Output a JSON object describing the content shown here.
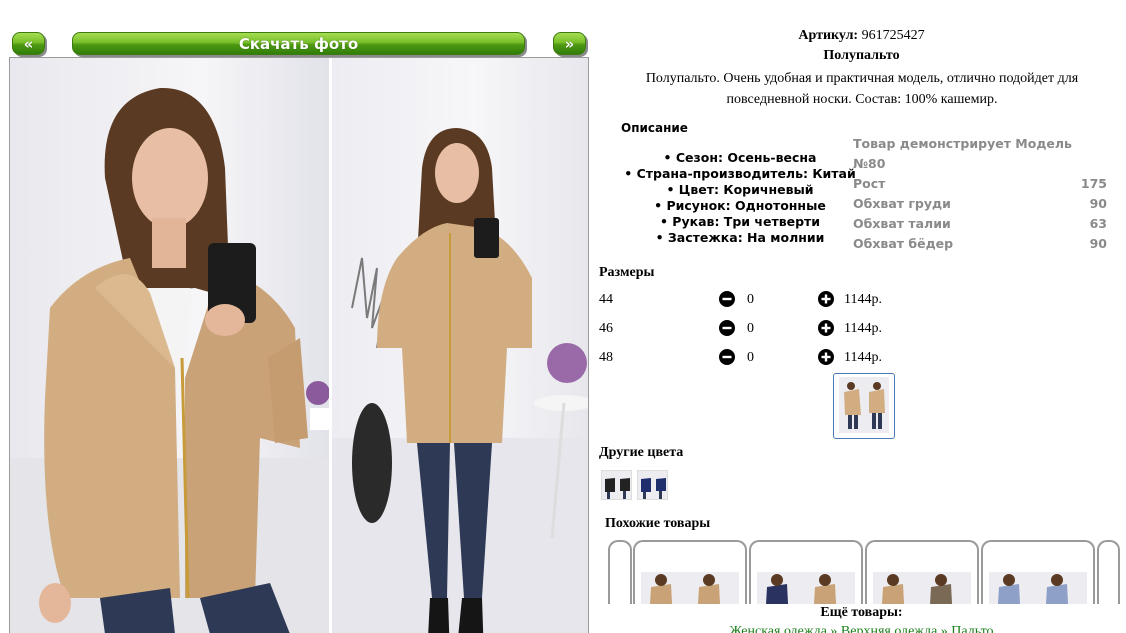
{
  "nav": {
    "prev_label": "«",
    "download_label": "Скачать фото",
    "next_label": "»"
  },
  "product": {
    "article_label": "Артикул:",
    "article_value": "961725427",
    "name": "Полупальто",
    "description": "Полупальто. Очень удобная и практичная модель, отлично подойдет для повседневной носки. Состав: 100% кашемир."
  },
  "details": {
    "title": "Описание",
    "items": [
      "• Сезон: Осень-весна",
      "• Страна-производитель: Китай",
      "• Цвет: Коричневый",
      "• Рисунок: Однотонные",
      "• Рукав: Три четверти",
      "• Застежка: На молнии"
    ]
  },
  "model": {
    "title": "Товар демонстрирует Модель №80",
    "rows": [
      {
        "label": "Рост",
        "value": "175"
      },
      {
        "label": "Обхват груди",
        "value": "90"
      },
      {
        "label": "Обхват талии",
        "value": "63"
      },
      {
        "label": "Обхват бёдер",
        "value": "90"
      }
    ]
  },
  "sizes": {
    "title": "Размеры",
    "rows": [
      {
        "size": "44",
        "qty": "0",
        "price": "1144р."
      },
      {
        "size": "46",
        "qty": "0",
        "price": "1144р."
      },
      {
        "size": "48",
        "qty": "0",
        "price": "1144р."
      }
    ]
  },
  "other_colors": {
    "title": "Другие цвета"
  },
  "similar": {
    "title": "Похожие товары"
  },
  "more": {
    "title": "Ещё товары:",
    "links": [
      "Женская одежда",
      "Верхняя одежда",
      "Пальто"
    ],
    "separator": " » "
  },
  "colors": {
    "button_green": "#5aa81c",
    "coat": "#d2ad82",
    "jeans": "#2e3a55",
    "link": "#1a7f1a"
  }
}
